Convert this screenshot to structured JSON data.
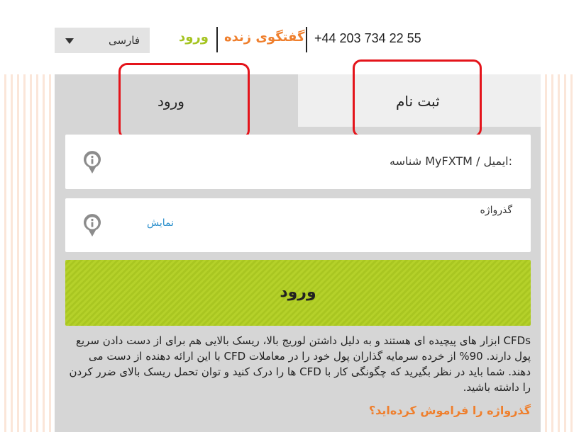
{
  "header": {
    "language": "فارسی",
    "login_link": "ورود",
    "live_chat": "گفتگوی زنده",
    "phone": "+44 203 734 22 55"
  },
  "tabs": {
    "login": "ورود",
    "register": "ثبت نام"
  },
  "form": {
    "username_label": "شناسه MyFXTM / ایمیل:",
    "password_label": "گذرواژه",
    "show_password": "نمایش",
    "submit_label": "ورود"
  },
  "disclaimer": "CFDs ابزار های پیچیده ای هستند و به دلیل داشتن لوریج بالا، ریسک بالایی هم برای از دست دادن سریع پول دارند. 90% از خرده سرمایه گذاران پول خود را در معاملات CFD با این ارائه دهنده از دست می دهند. شما باید در نظر بگیرید که چگونگی کار با CFD ها را درک کنید و توان تحمل ریسک بالای ضرر کردن را داشته باشید.",
  "forgot_password": "گذرواژه را فراموش کرده‌اید؟",
  "colors": {
    "accent_green": "#a9c621",
    "accent_orange": "#ef7f2d",
    "highlight_red": "#e4141b",
    "link_blue": "#2a8fcc"
  }
}
